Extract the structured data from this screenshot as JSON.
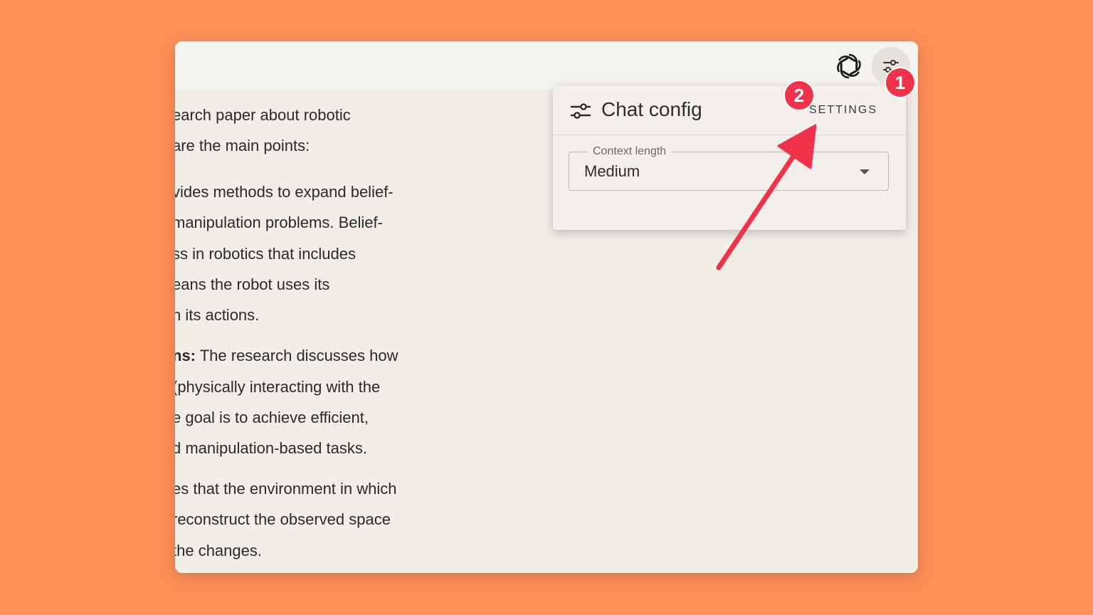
{
  "chat": {
    "lines": [
      "earch paper about robotic",
      "are the main points:",
      "vides methods to expand belief-",
      "manipulation problems. Belief-",
      "ss in robotics that includes",
      "eans the robot uses its",
      "n its actions.",
      "ns:",
      " The research discusses how",
      " (physically interacting with the",
      "e goal is to achieve efficient,",
      "d manipulation-based tasks.",
      "es that the environment in which",
      "reconstruct the observed space",
      "the changes."
    ]
  },
  "topbar": {
    "logo_icon": "openai-logo-icon",
    "settings_icon": "sliders-icon"
  },
  "panel": {
    "title": "Chat config",
    "settings_label": "SETTINGS",
    "context_label": "Context length",
    "context_value": "Medium"
  },
  "annotations": {
    "badge_1": "1",
    "badge_2": "2",
    "color": "#F0334B"
  }
}
